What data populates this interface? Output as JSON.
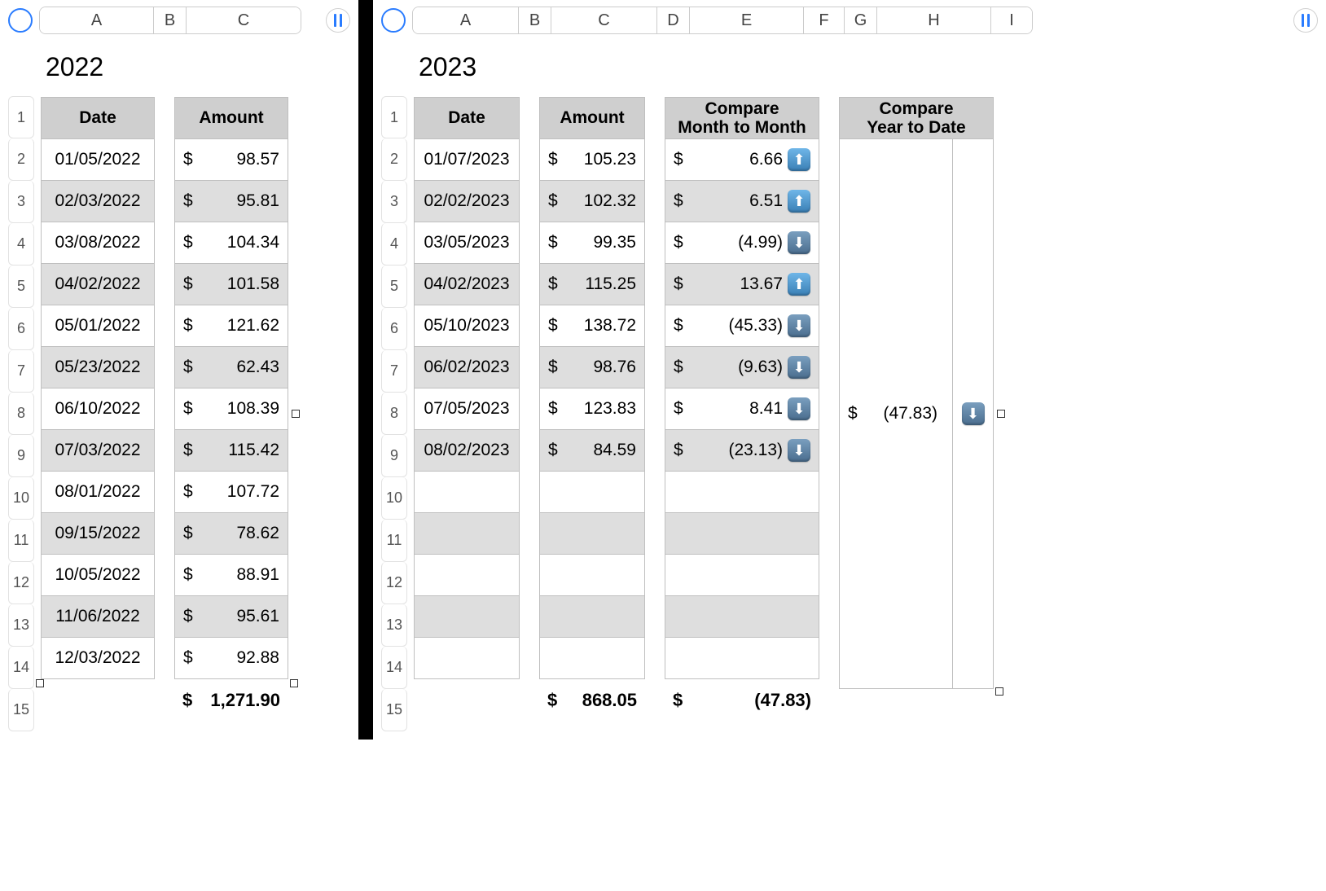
{
  "left": {
    "title": "2022",
    "col_headers": [
      "A",
      "B",
      "C"
    ],
    "row_numbers": [
      "1",
      "2",
      "3",
      "4",
      "5",
      "6",
      "7",
      "8",
      "9",
      "10",
      "11",
      "12",
      "13",
      "14",
      "15"
    ],
    "date_header": "Date",
    "amount_header": "Amount",
    "currency": "$",
    "rows": [
      {
        "date": "01/05/2022",
        "amount": "98.57"
      },
      {
        "date": "02/03/2022",
        "amount": "95.81"
      },
      {
        "date": "03/08/2022",
        "amount": "104.34"
      },
      {
        "date": "04/02/2022",
        "amount": "101.58"
      },
      {
        "date": "05/01/2022",
        "amount": "121.62"
      },
      {
        "date": "05/23/2022",
        "amount": "62.43"
      },
      {
        "date": "06/10/2022",
        "amount": "108.39"
      },
      {
        "date": "07/03/2022",
        "amount": "115.42"
      },
      {
        "date": "08/01/2022",
        "amount": "107.72"
      },
      {
        "date": "09/15/2022",
        "amount": "78.62"
      },
      {
        "date": "10/05/2022",
        "amount": "88.91"
      },
      {
        "date": "11/06/2022",
        "amount": "95.61"
      },
      {
        "date": "12/03/2022",
        "amount": "92.88"
      }
    ],
    "total": "1,271.90"
  },
  "right": {
    "title": "2023",
    "col_headers": [
      "A",
      "B",
      "C",
      "D",
      "E",
      "F",
      "G",
      "H",
      "I"
    ],
    "row_numbers": [
      "1",
      "2",
      "3",
      "4",
      "5",
      "6",
      "7",
      "8",
      "9",
      "10",
      "11",
      "12",
      "13",
      "14",
      "15"
    ],
    "date_header": "Date",
    "amount_header": "Amount",
    "compare_header": "Compare Month to Month",
    "ytd_header": "Compare Year to Date",
    "currency": "$",
    "rows": [
      {
        "date": "01/07/2023",
        "amount": "105.23",
        "diff": "6.66",
        "dir": "up"
      },
      {
        "date": "02/02/2023",
        "amount": "102.32",
        "diff": "6.51",
        "dir": "up"
      },
      {
        "date": "03/05/2023",
        "amount": "99.35",
        "diff": "(4.99)",
        "dir": "down"
      },
      {
        "date": "04/02/2023",
        "amount": "115.25",
        "diff": "13.67",
        "dir": "up"
      },
      {
        "date": "05/10/2023",
        "amount": "138.72",
        "diff": "(45.33)",
        "dir": "down"
      },
      {
        "date": "06/02/2023",
        "amount": "98.76",
        "diff": "(9.63)",
        "dir": "down"
      },
      {
        "date": "07/05/2023",
        "amount": "123.83",
        "diff": "8.41",
        "dir": "down"
      },
      {
        "date": "08/02/2023",
        "amount": "84.59",
        "diff": "(23.13)",
        "dir": "down"
      }
    ],
    "empty_rows": 5,
    "total_amount": "868.05",
    "total_diff": "(47.83)",
    "ytd_value": "(47.83)",
    "ytd_dir": "down"
  }
}
